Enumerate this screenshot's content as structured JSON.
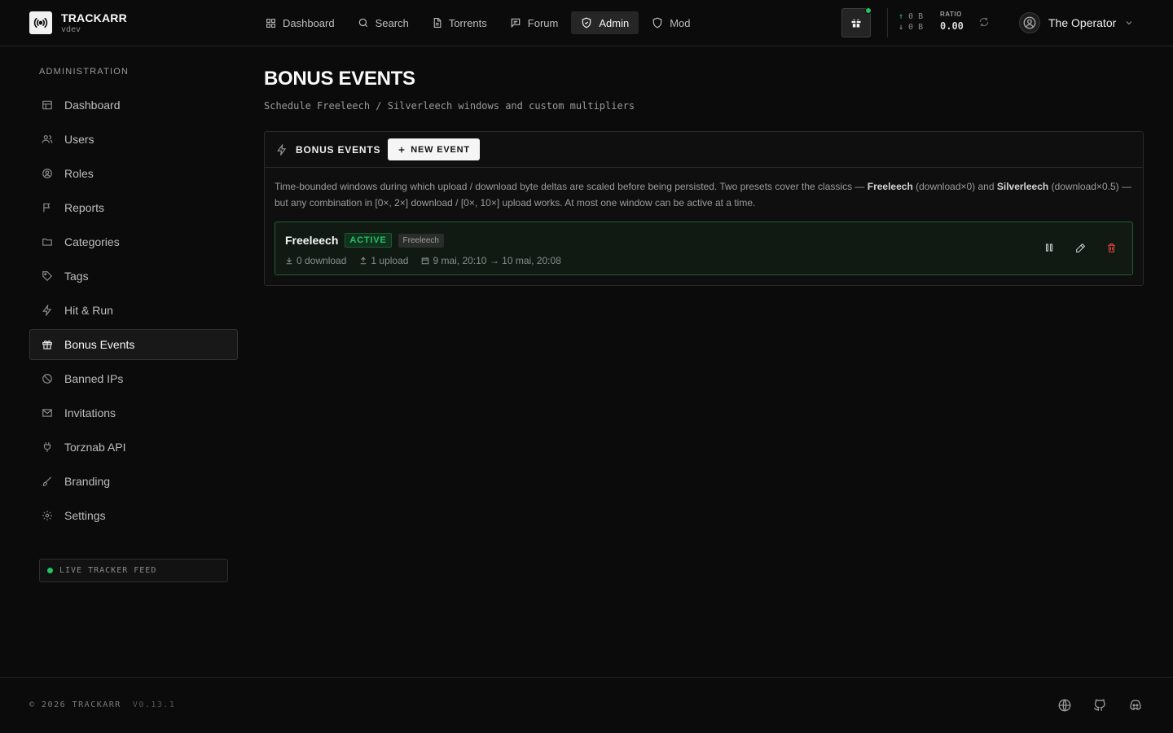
{
  "brand": {
    "name": "TRACKARR",
    "version": "vdev"
  },
  "nav": {
    "items": [
      {
        "label": "Dashboard",
        "icon": "grid-icon",
        "active": false
      },
      {
        "label": "Search",
        "icon": "search-icon",
        "active": false
      },
      {
        "label": "Torrents",
        "icon": "file-icon",
        "active": false
      },
      {
        "label": "Forum",
        "icon": "message-icon",
        "active": false
      },
      {
        "label": "Admin",
        "icon": "shield-check-icon",
        "active": true
      },
      {
        "label": "Mod",
        "icon": "shield-icon",
        "active": false
      }
    ]
  },
  "header": {
    "uploaded": "0 B",
    "downloaded": "0 B",
    "ratio_label": "RATIO",
    "ratio_value": "0.00",
    "user_name": "The Operator",
    "accent": "#22c55e"
  },
  "sidebar": {
    "heading": "ADMINISTRATION",
    "items": [
      {
        "label": "Dashboard",
        "icon": "layout-icon",
        "active": false
      },
      {
        "label": "Users",
        "icon": "users-icon",
        "active": false
      },
      {
        "label": "Roles",
        "icon": "roles-icon",
        "active": false
      },
      {
        "label": "Reports",
        "icon": "flag-icon",
        "active": false
      },
      {
        "label": "Categories",
        "icon": "folder-icon",
        "active": false
      },
      {
        "label": "Tags",
        "icon": "tag-icon",
        "active": false
      },
      {
        "label": "Hit & Run",
        "icon": "zap-icon",
        "active": false
      },
      {
        "label": "Bonus Events",
        "icon": "gift-icon",
        "active": true
      },
      {
        "label": "Banned IPs",
        "icon": "ban-icon",
        "active": false
      },
      {
        "label": "Invitations",
        "icon": "mail-icon",
        "active": false
      },
      {
        "label": "Torznab API",
        "icon": "plug-icon",
        "active": false
      },
      {
        "label": "Branding",
        "icon": "brush-icon",
        "active": false
      },
      {
        "label": "Settings",
        "icon": "gear-icon",
        "active": false
      }
    ],
    "live_feed": "LIVE TRACKER FEED"
  },
  "main": {
    "title": "BONUS EVENTS",
    "subtitle": "Schedule Freeleech / Silverleech windows and custom multipliers",
    "card": {
      "title": "BONUS EVENTS",
      "new_button": "NEW EVENT",
      "desc_part1": "Time-bounded windows during which upload / download byte deltas are scaled before being persisted. Two presets cover the classics — ",
      "desc_bold1": "Freeleech",
      "desc_part2": " (download×0) and ",
      "desc_bold2": "Silverleech",
      "desc_part3": " (download×0.5) — but any combination in [0×, 2×] download / [0×, 10×] upload works. At most one window can be active at a time."
    },
    "events": [
      {
        "name": "Freeleech",
        "status": "ACTIVE",
        "preset": "Freeleech",
        "download": "0 download",
        "upload": "1 upload",
        "window": "9 mai, 20:10 → 10 mai, 20:08"
      }
    ]
  },
  "footer": {
    "copyright": "© 2026 TRACKARR",
    "version": "V0.13.1"
  }
}
